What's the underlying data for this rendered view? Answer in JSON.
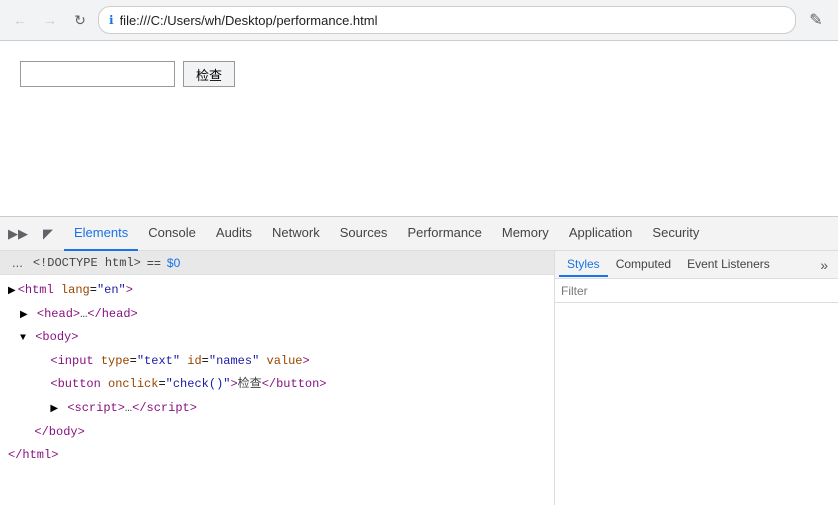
{
  "browser": {
    "back_disabled": true,
    "forward_disabled": true,
    "address": "file:///C:/Users/wh/Desktop/performance.html",
    "address_icon": "ℹ"
  },
  "page": {
    "input_placeholder": "",
    "button_label": "检查"
  },
  "devtools": {
    "tabs": [
      {
        "id": "elements",
        "label": "Elements",
        "active": true
      },
      {
        "id": "console",
        "label": "Console",
        "active": false
      },
      {
        "id": "audits",
        "label": "Audits",
        "active": false
      },
      {
        "id": "network",
        "label": "Network",
        "active": false
      },
      {
        "id": "sources",
        "label": "Sources",
        "active": false
      },
      {
        "id": "performance",
        "label": "Performance",
        "active": false
      },
      {
        "id": "memory",
        "label": "Memory",
        "active": false
      },
      {
        "id": "application",
        "label": "Application",
        "active": false
      },
      {
        "id": "security",
        "label": "Security",
        "active": false
      }
    ],
    "dom_header": {
      "node": "<!DOCTYPE html>",
      "equals": "==",
      "dollar": "$0"
    },
    "dom_lines": [
      {
        "indent": 0,
        "content": "html_open",
        "text": "<html lang=\"en\">"
      },
      {
        "indent": 1,
        "content": "head",
        "text": "▶ <head>…</head>"
      },
      {
        "indent": 1,
        "content": "body_open",
        "text": "▼ <body>"
      },
      {
        "indent": 2,
        "content": "input",
        "text": "<input type=\"text\" id=\"names\" value>"
      },
      {
        "indent": 2,
        "content": "button",
        "text": "<button onclick=\"check()\">检查</button>"
      },
      {
        "indent": 2,
        "content": "script",
        "text": "▶ <script>…</script>"
      },
      {
        "indent": 1,
        "content": "body_close",
        "text": "</body>"
      },
      {
        "indent": 0,
        "content": "html_close",
        "text": "</html>"
      }
    ],
    "styles_tabs": [
      {
        "id": "styles",
        "label": "Styles",
        "active": true
      },
      {
        "id": "computed",
        "label": "Computed",
        "active": false
      },
      {
        "id": "event_listeners",
        "label": "Event Listeners",
        "active": false
      }
    ],
    "filter_label": "Filter"
  }
}
